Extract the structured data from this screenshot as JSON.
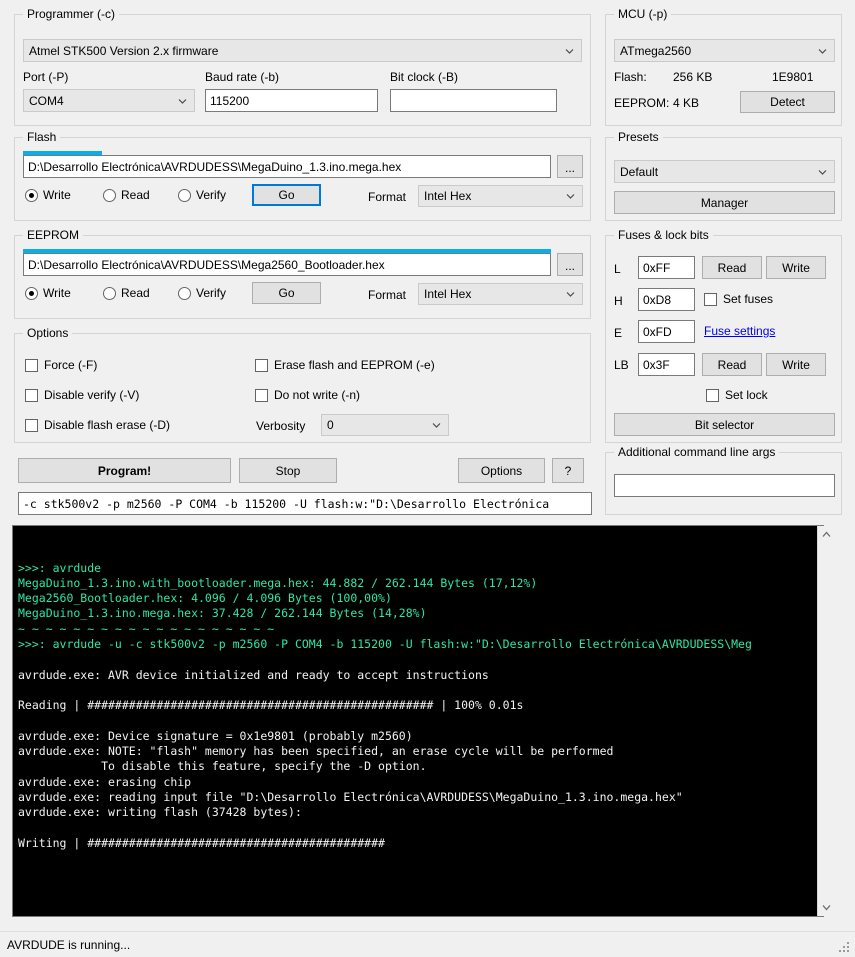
{
  "programmer": {
    "title": "Programmer (-c)",
    "combo_value": "Atmel STK500 Version 2.x firmware",
    "port_label": "Port (-P)",
    "port_value": "COM4",
    "baud_label": "Baud rate (-b)",
    "baud_value": "115200",
    "bitclock_label": "Bit clock (-B)",
    "bitclock_value": ""
  },
  "mcu": {
    "title": "MCU (-p)",
    "combo_value": "ATmega2560",
    "flash_label": "Flash:",
    "flash_value": "256 KB",
    "signature": "1E9801",
    "eeprom_label": "EEPROM:",
    "eeprom_value": "4 KB",
    "detect_label": "Detect"
  },
  "flash": {
    "title": "Flash",
    "file": "D:\\Desarrollo Electrónica\\AVRDUDESS\\MegaDuino_1.3.ino.mega.hex",
    "browse_label": "...",
    "write_label": "Write",
    "read_label": "Read",
    "verify_label": "Verify",
    "go_label": "Go",
    "format_label": "Format",
    "format_value": "Intel Hex",
    "progress_percent": 15
  },
  "eeprom": {
    "title": "EEPROM",
    "file": "D:\\Desarrollo Electrónica\\AVRDUDESS\\Mega2560_Bootloader.hex",
    "browse_label": "...",
    "write_label": "Write",
    "read_label": "Read",
    "verify_label": "Verify",
    "go_label": "Go",
    "format_label": "Format",
    "format_value": "Intel Hex",
    "progress_percent": 100
  },
  "options": {
    "title": "Options",
    "force_label": "Force (-F)",
    "disable_verify_label": "Disable verify (-V)",
    "disable_flash_erase_label": "Disable flash erase (-D)",
    "erase_label": "Erase flash and EEPROM (-e)",
    "do_not_write_label": "Do not write (-n)",
    "verbosity_label": "Verbosity",
    "verbosity_value": "0"
  },
  "presets": {
    "title": "Presets",
    "value": "Default",
    "manager_label": "Manager"
  },
  "fuses": {
    "title": "Fuses & lock bits",
    "l_label": "L",
    "l_value": "0xFF",
    "h_label": "H",
    "h_value": "0xD8",
    "e_label": "E",
    "e_value": "0xFD",
    "lb_label": "LB",
    "lb_value": "0x3F",
    "read_label": "Read",
    "write_label": "Write",
    "set_fuses_label": "Set fuses",
    "fuse_settings_label": "Fuse settings",
    "set_lock_label": "Set lock",
    "bit_selector_label": "Bit selector"
  },
  "actions": {
    "program_label": "Program!",
    "stop_label": "Stop",
    "options_label": "Options",
    "help_label": "?",
    "command_line": "-c stk500v2 -p m2560 -P COM4 -b 115200 -U flash:w:\"D:\\Desarrollo Electrónica"
  },
  "extra_args": {
    "title": "Additional command line args",
    "value": ""
  },
  "console": {
    "lines": [
      {
        "color": "green",
        "text": ">>>: avrdude"
      },
      {
        "color": "green",
        "text": "MegaDuino_1.3.ino.with_bootloader.mega.hex: 44.882 / 262.144 Bytes (17,12%)"
      },
      {
        "color": "green",
        "text": "Mega2560_Bootloader.hex: 4.096 / 4.096 Bytes (100,00%)"
      },
      {
        "color": "green",
        "text": "MegaDuino_1.3.ino.mega.hex: 37.428 / 262.144 Bytes (14,28%)"
      },
      {
        "color": "green",
        "text": "~ ~ ~ ~ ~ ~ ~ ~ ~ ~ ~ ~ ~ ~ ~ ~ ~ ~ ~"
      },
      {
        "color": "green",
        "text": ">>>: avrdude -u -c stk500v2 -p m2560 -P COM4 -b 115200 -U flash:w:\"D:\\Desarrollo Electrónica\\AVRDUDESS\\Meg"
      },
      {
        "color": "white",
        "text": ""
      },
      {
        "color": "white",
        "text": "avrdude.exe: AVR device initialized and ready to accept instructions"
      },
      {
        "color": "white",
        "text": ""
      },
      {
        "color": "white",
        "text": "Reading | ################################################## | 100% 0.01s"
      },
      {
        "color": "white",
        "text": ""
      },
      {
        "color": "white",
        "text": "avrdude.exe: Device signature = 0x1e9801 (probably m2560)"
      },
      {
        "color": "white",
        "text": "avrdude.exe: NOTE: \"flash\" memory has been specified, an erase cycle will be performed"
      },
      {
        "color": "white",
        "text": "            To disable this feature, specify the -D option."
      },
      {
        "color": "white",
        "text": "avrdude.exe: erasing chip"
      },
      {
        "color": "white",
        "text": "avrdude.exe: reading input file \"D:\\Desarrollo Electrónica\\AVRDUDESS\\MegaDuino_1.3.ino.mega.hex\""
      },
      {
        "color": "white",
        "text": "avrdude.exe: writing flash (37428 bytes):"
      },
      {
        "color": "white",
        "text": ""
      },
      {
        "color": "white",
        "text": "Writing | ###########################################"
      }
    ]
  },
  "statusbar": {
    "text": "AVRDUDE is running..."
  },
  "colors": {
    "accent": "#0078d7",
    "progress": "#06b0f0",
    "console_green": "#2ee6a8",
    "console_white": "#f2f2f2",
    "link": "#0000ee"
  }
}
